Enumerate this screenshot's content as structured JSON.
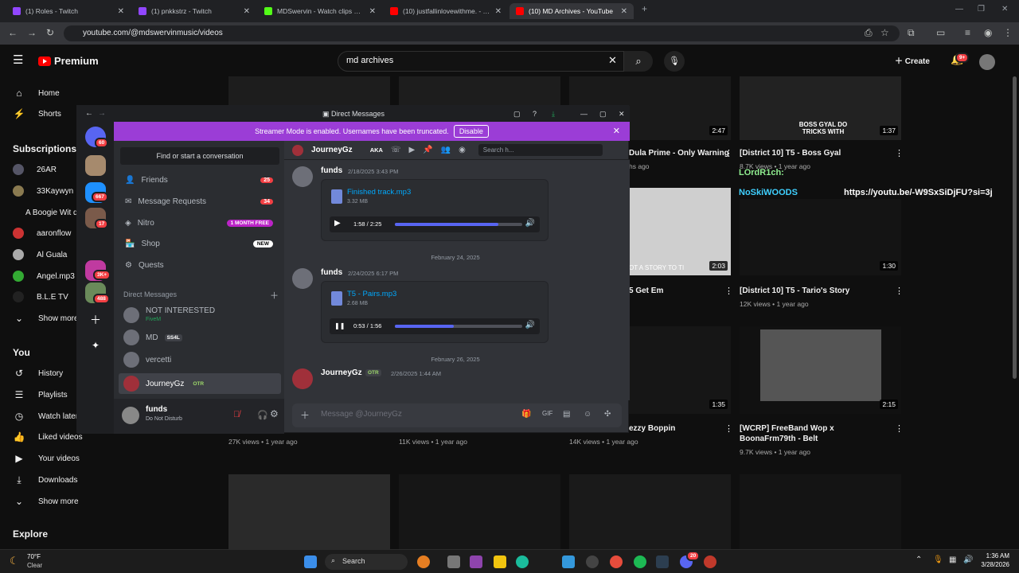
{
  "browser": {
    "tabs": [
      {
        "label": "(1) Roles - Twitch",
        "color": "#9146ff",
        "close": "✕"
      },
      {
        "label": "(1) pnkkstrz - Twitch",
        "color": "#9146ff",
        "close": "✕"
      },
      {
        "label": "MDSwervin - Watch clips on Kick",
        "color": "#53fc18",
        "close": "✕"
      },
      {
        "label": "(10) justfallinlovewithme. - YouTube",
        "color": "#ff0000",
        "close": "✕"
      },
      {
        "label": "(10) MD Archives - YouTube",
        "color": "#ff0000",
        "close": "✕"
      }
    ],
    "new_tab": "+",
    "url": "youtube.com/@mdswervinmusic/videos"
  },
  "youtube": {
    "brand": "Premium",
    "search_value": "md archives",
    "create": "Create",
    "notif_badge": "9+",
    "sidebar": {
      "home": "Home",
      "shorts": "Shorts",
      "subscriptions": "Subscriptions",
      "subs": [
        "26AR",
        "33Kaywyn",
        "A Boogie Wit da Hoodie",
        "aaronflow",
        "Al Guala",
        "Angel.mp3",
        "B.L.E TV"
      ],
      "show_more": "Show more",
      "you": "You",
      "history": "History",
      "playlists": "Playlists",
      "watch_later": "Watch later",
      "liked": "Liked videos",
      "your_videos": "Your videos",
      "downloads": "Downloads",
      "show_more2": "Show more",
      "explore": "Explore"
    },
    "videos": [
      {
        "title": "Dula Prime - Only Warning",
        "meta": "hs ago",
        "duration": "2:47"
      },
      {
        "title": "[District 10] T5 - Boss Gyal",
        "meta": "8.7K views • 1 year ago",
        "duration": "1:37",
        "thumb_text": "BOSS GYAL DO TRICKS WITH"
      },
      {
        "title": "5 Get Em",
        "meta": "",
        "duration": "2:03",
        "thumb_text": "OT A STORY TO TI"
      },
      {
        "title": "[District 10] T5 - Tario's Story",
        "meta": "12K views • 1 year ago",
        "duration": "1:30"
      },
      {
        "title": "ezzy Boppin",
        "meta": "14K views • 1 year ago",
        "duration": "1:35"
      },
      {
        "title": "[WCRP] FreeBand Wop x BoonaFrm79th - Belt",
        "meta": "9.7K views • 1 year ago",
        "duration": "2:15"
      }
    ],
    "row2_meta": [
      "27K views • 1 year ago",
      "11K views • 1 year ago"
    ],
    "overlay": {
      "line1": "LOrdR1ch:",
      "line2": "NoSkiWOODS",
      "line3": "https://youtu.be/-W9SxSiDjFU?si=3j"
    }
  },
  "discord": {
    "title": "Direct Messages",
    "banner": "Streamer Mode is enabled. Usernames have been truncated.",
    "disable": "Disable",
    "rail_badges": [
      "60",
      "667",
      "17",
      "3K+",
      "488"
    ],
    "find": "Find or start a conversation",
    "menu": [
      {
        "label": "Friends",
        "count": "25"
      },
      {
        "label": "Message Requests",
        "count": "34"
      },
      {
        "label": "Nitro",
        "pill": "1 MONTH FREE"
      },
      {
        "label": "Shop",
        "pill": "NEW"
      },
      {
        "label": "Quests"
      }
    ],
    "dm_header": "Direct Messages",
    "dms": [
      {
        "name": "NOT INTERESTED",
        "sub": "FiveM"
      },
      {
        "name": "MD",
        "tag": "SS4L"
      },
      {
        "name": "vercetti"
      },
      {
        "name": "JourneyGz",
        "tag": "OTR"
      }
    ],
    "user": {
      "name": "funds",
      "status": "Do Not Disturb"
    },
    "chat_name": "JourneyGz",
    "aka": "AKA",
    "search_ph": "Search h...",
    "messages": [
      {
        "author": "funds",
        "time": "2/18/2025 3:43 PM",
        "file": "Finished track.mp3",
        "size": "3.32 MB",
        "pos": "1:58 / 2:25",
        "progress": 0.81,
        "state": "▶"
      },
      {
        "sep": "February 24, 2025"
      },
      {
        "author": "funds",
        "time": "2/24/2025 6:17 PM",
        "file": "T5 - Pairs.mp3",
        "size": "2.68 MB",
        "pos": "0:53 / 1:56",
        "progress": 0.46,
        "state": "❚❚"
      },
      {
        "sep": "February 26, 2025"
      },
      {
        "author": "JourneyGz",
        "tag": "OTR",
        "time": "2/26/2025 1:44 AM"
      }
    ],
    "input_ph": "Message @JourneyGz"
  },
  "taskbar": {
    "temp": "70°F",
    "weather": "Clear",
    "search": "Search",
    "time": "1:36 AM",
    "date": "3/28/2026",
    "dc_badge": "20"
  }
}
